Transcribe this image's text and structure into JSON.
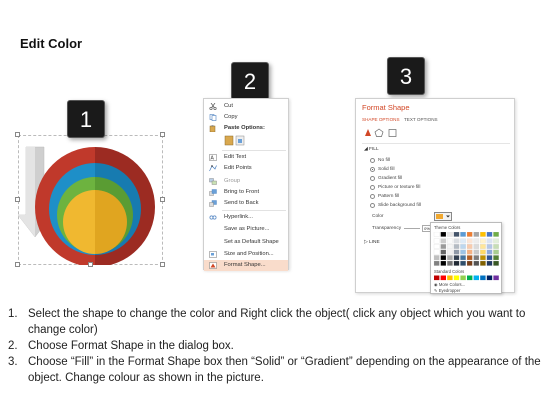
{
  "title": "Edit Color",
  "badges": [
    "1",
    "2",
    "3"
  ],
  "context_menu": {
    "items": [
      {
        "label": "Cut",
        "icon": "scissors-icon"
      },
      {
        "label": "Copy",
        "icon": "copy-icon"
      },
      {
        "label": "Paste Options:",
        "icon": "paste-icon",
        "bold": true
      },
      {
        "label": "",
        "icon": "paste-option-icons"
      },
      {
        "label": "Edit Text",
        "icon": "edit-text-icon"
      },
      {
        "label": "Edit Points",
        "icon": "edit-points-icon"
      },
      {
        "label": "Group",
        "icon": "group-icon"
      },
      {
        "label": "Bring to Front",
        "icon": "bring-front-icon"
      },
      {
        "label": "Send to Back",
        "icon": "send-back-icon"
      },
      {
        "label": "Hyperlink...",
        "icon": "hyperlink-icon"
      },
      {
        "label": "Save as Picture...",
        "icon": ""
      },
      {
        "label": "Set as Default Shape",
        "icon": ""
      },
      {
        "label": "Size and Position...",
        "icon": "size-position-icon"
      },
      {
        "label": "Format Shape...",
        "icon": "format-shape-icon",
        "highlight": true
      }
    ]
  },
  "format_pane": {
    "title": "Format Shape",
    "tab_shape": "SHAPE OPTIONS",
    "tab_text": "TEXT OPTIONS",
    "fill_header": "FILL",
    "fill_options": [
      "No fill",
      "Solid fill",
      "Gradient fill",
      "Picture or texture fill",
      "Pattern fill",
      "Slide background fill"
    ],
    "fill_selected": "Solid fill",
    "color_label": "Color",
    "transparency_label": "Transparency",
    "transparency_value": "0%",
    "line_header": "LINE",
    "palette": {
      "theme_label": "Theme Colors",
      "standard_label": "Standard Colors",
      "more_colors": "More Colors...",
      "eyedropper": "Eyedropper"
    }
  },
  "instructions": [
    {
      "num": "1.",
      "text": "Select the shape to change the color and Right click the object( click any object which you want to change color)"
    },
    {
      "num": "2.",
      "text": "Choose Format Shape in the dialog box."
    },
    {
      "num": "3.",
      "text": "Choose “Fill” in the Format Shape box then “Solid” or “Gradient” depending on the appearance of the object. Change colour as shown in the picture."
    }
  ],
  "colors": {
    "badge": "#1a1a1a",
    "ring_red": "#c0392b",
    "ring_blue": "#1e8fc8",
    "ring_green": "#6db33f",
    "ring_yellow": "#f0b830",
    "accent": "#d24726",
    "menu_highlight": "#f9dccb"
  }
}
